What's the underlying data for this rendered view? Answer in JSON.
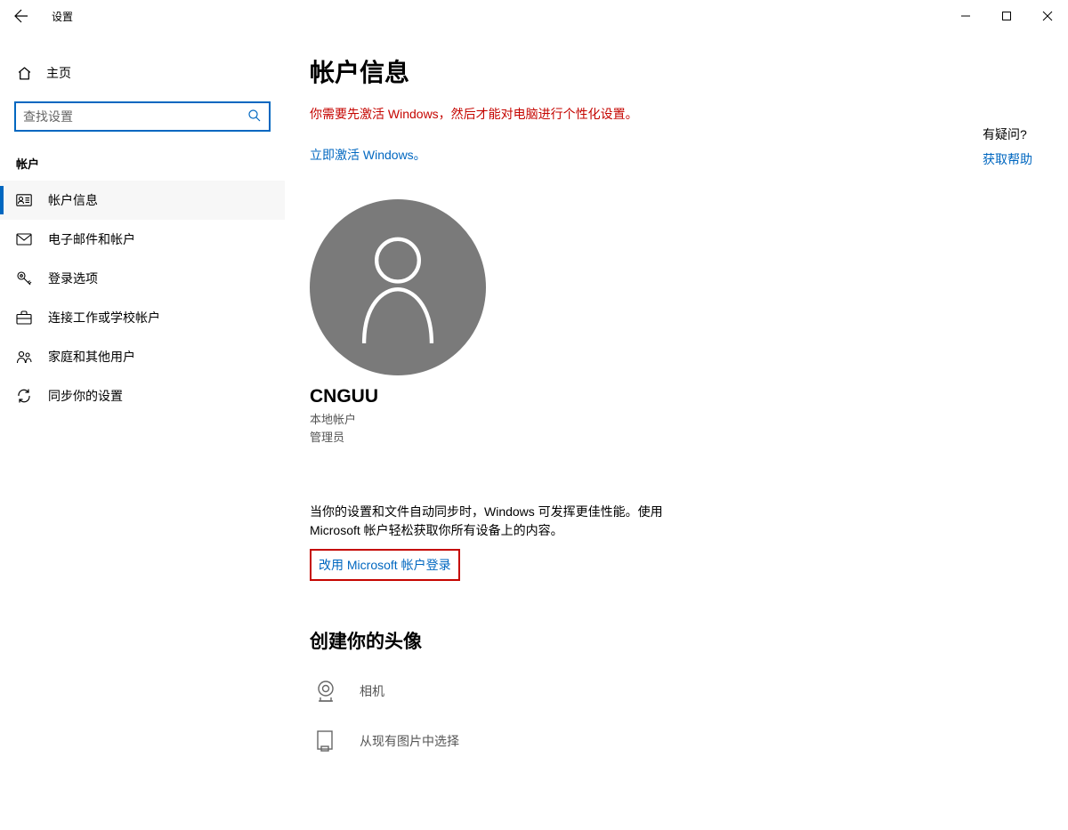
{
  "titlebar": {
    "app_title": "设置"
  },
  "sidebar": {
    "home_label": "主页",
    "search_placeholder": "查找设置",
    "category_label": "帐户",
    "items": [
      {
        "label": "帐户信息"
      },
      {
        "label": "电子邮件和帐户"
      },
      {
        "label": "登录选项"
      },
      {
        "label": "连接工作或学校帐户"
      },
      {
        "label": "家庭和其他用户"
      },
      {
        "label": "同步你的设置"
      }
    ]
  },
  "main": {
    "page_title": "帐户信息",
    "warning_text": "你需要先激活 Windows，然后才能对电脑进行个性化设置。",
    "activate_link": "立即激活 Windows。",
    "username": "CNGUU",
    "account_type": "本地帐户",
    "account_role": "管理员",
    "sync_text": "当你的设置和文件自动同步时，Windows 可发挥更佳性能。使用 Microsoft 帐户轻松获取你所有设备上的内容。",
    "ms_signin_link": "改用 Microsoft 帐户登录",
    "create_picture_title": "创建你的头像",
    "camera_label": "相机",
    "browse_label": "从现有图片中选择"
  },
  "help": {
    "question": "有疑问?",
    "link": "获取帮助"
  }
}
